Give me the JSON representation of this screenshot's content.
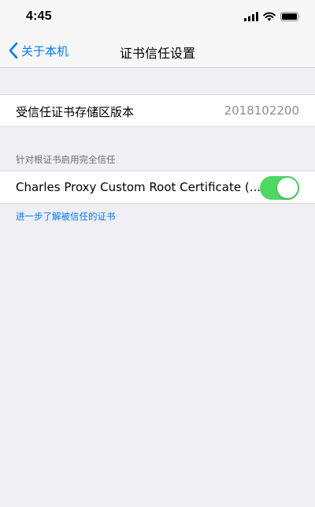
{
  "status_bar": {
    "time": "4:45",
    "icons": [
      "signal-icon",
      "wifi-icon",
      "battery-icon"
    ]
  },
  "nav": {
    "back_label": "关于本机",
    "title": "证书信任设置"
  },
  "trust_store": {
    "label": "受信任证书存储区版本",
    "value": "2018102200"
  },
  "full_trust_section": {
    "header": "针对根证书启用完全信任",
    "certificates": [
      {
        "name": "Charles Proxy Custom Root Certificate (...",
        "enabled": true
      }
    ],
    "footer_link": "进一步了解被信任的证书"
  },
  "colors": {
    "accent": "#007aff",
    "toggle_on": "#4cd964",
    "background": "#efeff4"
  }
}
